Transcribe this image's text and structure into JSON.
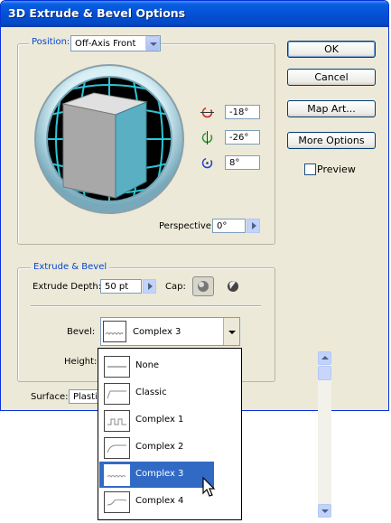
{
  "window": {
    "title": "3D Extrude & Bevel Options"
  },
  "position": {
    "label": "Position:",
    "preset": "Off-Axis Front"
  },
  "rotation": {
    "x": "-18°",
    "y": "-26°",
    "z": "8°"
  },
  "perspective": {
    "label": "Perspective:",
    "value": "0°"
  },
  "buttons": {
    "ok": "OK",
    "cancel": "Cancel",
    "map_art": "Map Art...",
    "more_options": "More Options"
  },
  "preview": {
    "label": "Preview",
    "checked": false
  },
  "extrude": {
    "section_title": "Extrude & Bevel",
    "depth_label": "Extrude Depth:",
    "depth_value": "50 pt",
    "cap_label": "Cap:"
  },
  "bevel": {
    "label": "Bevel:",
    "value": "Complex 3",
    "height_label": "Height:"
  },
  "surface": {
    "label": "Surface:",
    "value": "Plastic"
  },
  "bevel_options": [
    {
      "label": "None"
    },
    {
      "label": "Classic"
    },
    {
      "label": "Complex 1"
    },
    {
      "label": "Complex 2"
    },
    {
      "label": "Complex 3",
      "selected": true
    },
    {
      "label": "Complex 4"
    }
  ],
  "colors": {
    "titlebar": "#0351d4",
    "selection": "#316ac5",
    "cube_front": "#5aafc2",
    "trackball_grid": "#2cc6d6"
  }
}
